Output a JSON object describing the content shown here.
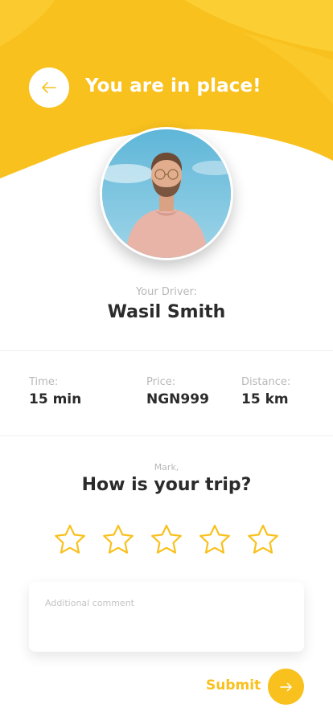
{
  "header": {
    "title": "You are in place!",
    "back_icon": "arrow-left-icon"
  },
  "driver": {
    "caption": "Your Driver:",
    "name": "Wasil Smith"
  },
  "trip": {
    "time": {
      "label": "Time:",
      "value": "15 min"
    },
    "price": {
      "label": "Price:",
      "value": "NGN999"
    },
    "distance": {
      "label": "Distance:",
      "value": "15 km"
    }
  },
  "rating": {
    "mark_label": "Mark,",
    "question": "How is your trip?",
    "stars_total": 5,
    "stars_selected": 0
  },
  "comment": {
    "placeholder": "Additional comment",
    "value": ""
  },
  "submit": {
    "label": "Submit",
    "icon": "arrow-right-icon"
  },
  "colors": {
    "accent": "#f8c11e",
    "accent_light": "#fcd138",
    "text_dark": "#2b2b2b",
    "text_muted": "#b8b8b8"
  }
}
